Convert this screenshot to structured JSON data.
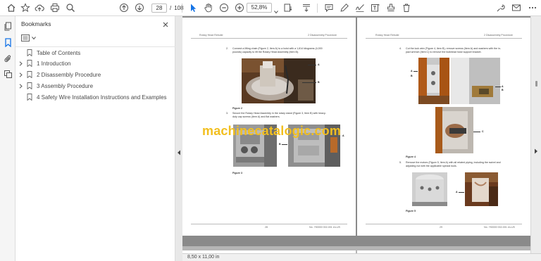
{
  "toolbar": {
    "current_page": "28",
    "page_separator": "/",
    "total_pages": "108",
    "zoom": "52,8%"
  },
  "bookmarks": {
    "title": "Bookmarks",
    "items": [
      {
        "label": "Table of Contents",
        "expandable": false
      },
      {
        "label": "1 Introduction",
        "expandable": true
      },
      {
        "label": "2 Disassembly Procedure",
        "expandable": true
      },
      {
        "label": "3 Assembly Procedure",
        "expandable": true
      },
      {
        "label": "4 Safety Wire Installation Instructions and Examples",
        "expandable": false
      }
    ]
  },
  "document": {
    "left_page": {
      "header_left": "Rotary Head Rebuild",
      "header_right": "2 Disassembly Procedure",
      "step2_num": "2.",
      "step2_line1": "Connect a lifting chain (Figure 2, Item A) to a hoist with a 1,814 kilograms (4,000",
      "step2_line2": "pounds) capacity to lift the Rotary Head Assembly (Item B).",
      "figure2": "Figure 2",
      "step3_num": "3.",
      "step3_line1": "Secure the Rotary Head Assembly in the rotary stand (Figure 3, Item B) with heavy-",
      "step3_line2": "duty cap screws (Item A) and flat washers.",
      "figure3": "Figure 3",
      "callout_a": "A",
      "callout_b": "B",
      "callout_b2": "B",
      "callout_a2": "A",
      "page_number": "28",
      "doc_number": "No. 750000 002-001 en-US"
    },
    "right_page": {
      "header_left": "Rotary Head Rebuild",
      "header_right": "2 Disassembly Procedure",
      "step4_num": "4.",
      "step4_line1": "Cut the lock wire (Figure 4, Item B), remove screws (Item A) and washers with the in-",
      "step4_line2": "pact wrench (Item C) to remove the bulkhead hose support bracket.",
      "figure4": "Figure 4",
      "step5_num": "5.",
      "step5_line1": "Remove the motors (Figure 5, Item A) with all related piping, including the swivel and",
      "step5_line2": "adjusting nut with the applicable special tools.",
      "figure5": "Figure 5",
      "callout_a": "A",
      "callout_b": "B",
      "callout_a_r": "A",
      "callout_b_r": "B",
      "callout_c": "C",
      "callout_a5": "A",
      "page_number": "29",
      "doc_number": "No. 750000 002-001 en-US"
    },
    "watermark": "machinecatalogic.com"
  },
  "status": {
    "page_size": "8,50 x 11,00 in"
  },
  "colors": {
    "doc_background": "#8a8a8a",
    "watermark": "#f2bf1f",
    "accent_blue": "#1473e6"
  }
}
